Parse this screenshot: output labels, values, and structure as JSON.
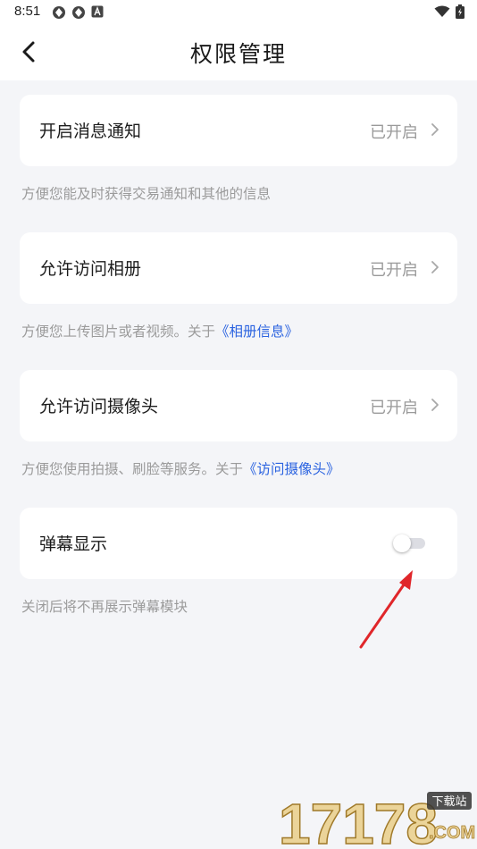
{
  "status_bar": {
    "time": "8:51"
  },
  "header": {
    "title": "权限管理"
  },
  "permissions": [
    {
      "label": "开启消息通知",
      "value": "已开启",
      "desc": "方便您能及时获得交易通知和其他的信息",
      "link": ""
    },
    {
      "label": "允许访问相册",
      "value": "已开启",
      "desc": "方便您上传图片或者视频。关于",
      "link": "《相册信息》"
    },
    {
      "label": "允许访问摄像头",
      "value": "已开启",
      "desc": "方便您使用拍摄、刷脸等服务。关于",
      "link": "《访问摄像头》"
    }
  ],
  "danmu": {
    "label": "弹幕显示",
    "enabled": false,
    "desc": "关闭后将不再展示弹幕模块"
  },
  "watermark": {
    "text": "17178",
    "badge": "下载站",
    "suffix": ".COM"
  },
  "colors": {
    "link": "#2c64e0",
    "annotation_arrow": "#e0262a"
  }
}
